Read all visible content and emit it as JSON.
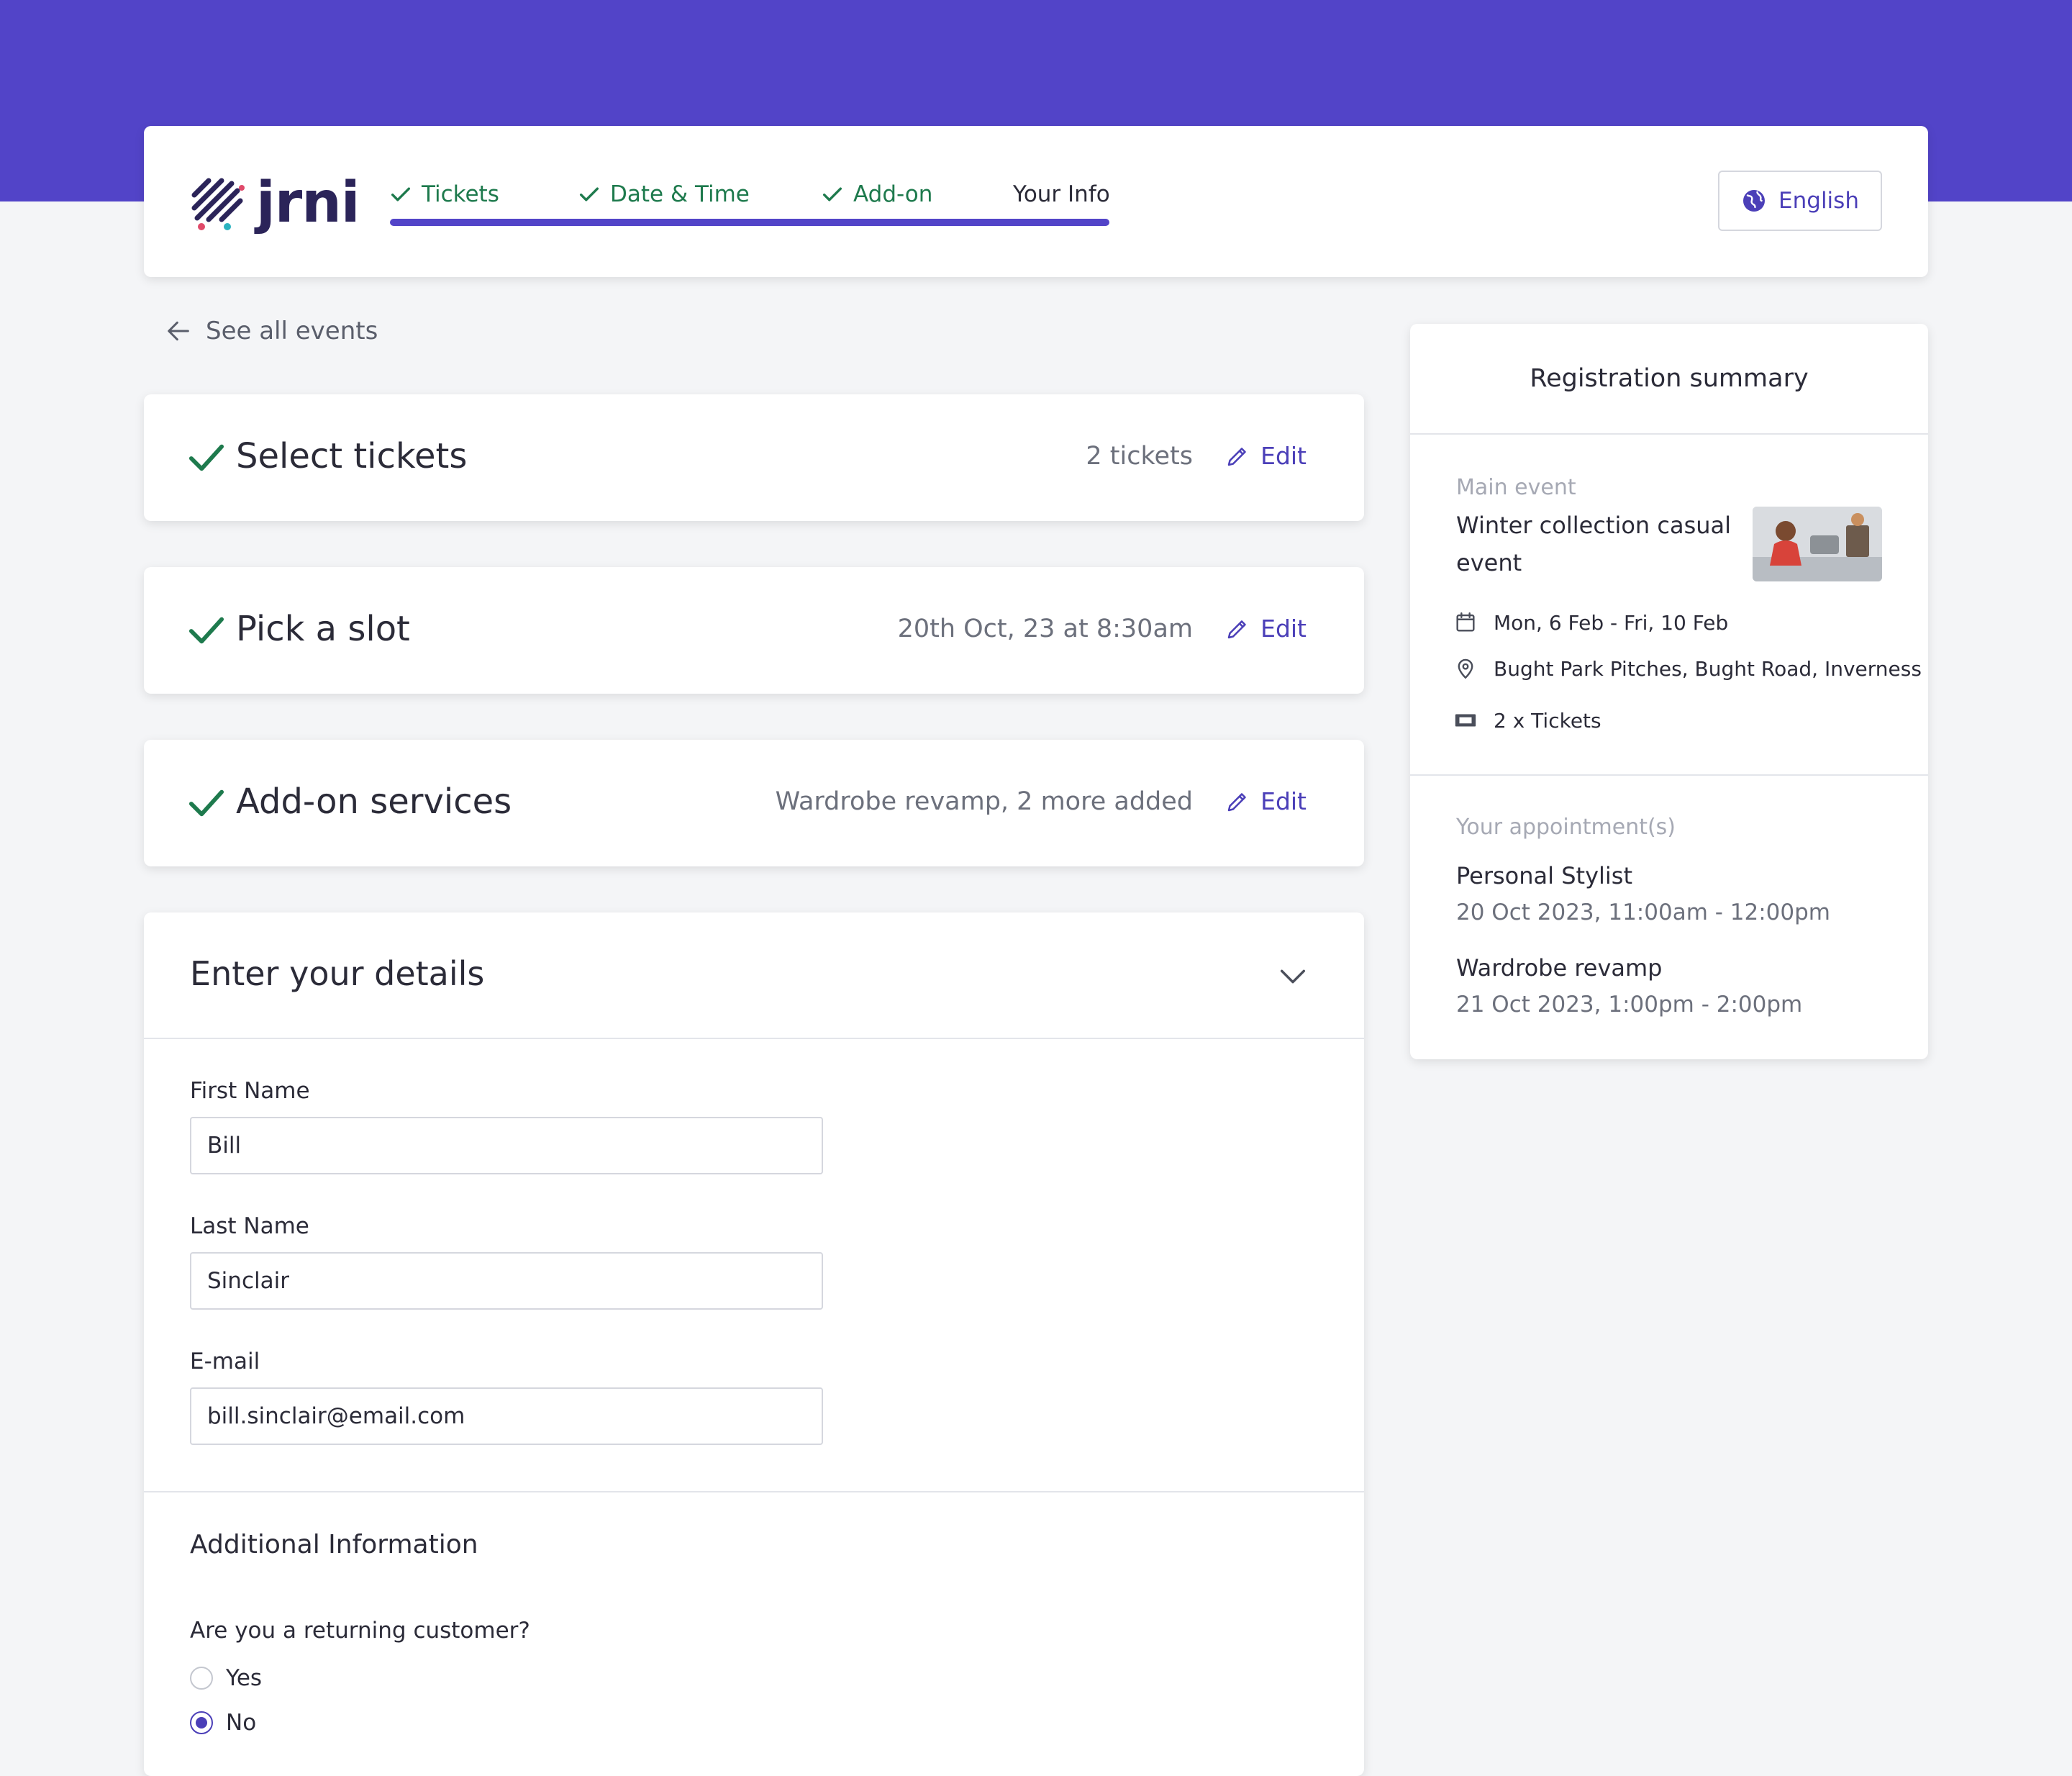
{
  "brand": {
    "logo_text": "jrni"
  },
  "steps": [
    {
      "label": "Tickets",
      "done": true
    },
    {
      "label": "Date & Time",
      "done": true
    },
    {
      "label": "Add-on",
      "done": true
    },
    {
      "label": "Your Info",
      "done": false
    }
  ],
  "language": {
    "label": "English"
  },
  "back_link": {
    "label": "See all events"
  },
  "cards": [
    {
      "title": "Select tickets",
      "summary": "2 tickets",
      "edit_label": "Edit"
    },
    {
      "title": "Pick a slot",
      "summary": "20th Oct, 23 at 8:30am",
      "edit_label": "Edit"
    },
    {
      "title": "Add-on services",
      "summary": "Wardrobe revamp, 2 more added",
      "edit_label": "Edit"
    }
  ],
  "details": {
    "title": "Enter your details",
    "first_name": {
      "label": "First Name",
      "value": "Bill"
    },
    "last_name": {
      "label": "Last Name",
      "value": "Sinclair"
    },
    "email": {
      "label": "E-mail",
      "value": "bill.sinclair@email.com"
    },
    "additional_title": "Additional Information",
    "question": "Are you a returning customer?",
    "options": [
      {
        "label": "Yes",
        "selected": false
      },
      {
        "label": "No",
        "selected": true
      }
    ]
  },
  "registration_summary": {
    "title": "Registration summary",
    "main_event_label": "Main event",
    "event_name": "Winter collection casual event",
    "dates": "Mon, 6 Feb - Fri, 10 Feb",
    "location": "Bught Park Pitches, Bught Road, Inverness",
    "tickets": "2 x Tickets",
    "appointments_label": "Your appointment(s)",
    "appointments": [
      {
        "name": "Personal Stylist",
        "time": "20 Oct 2023, 11:00am - 12:00pm"
      },
      {
        "name": "Wardrobe revamp",
        "time": "21 Oct 2023, 1:00pm - 2:00pm"
      }
    ]
  },
  "colors": {
    "brand_purple": "#5244c8",
    "success_green": "#1e7a4d",
    "link_purple": "#4b3fb8"
  }
}
